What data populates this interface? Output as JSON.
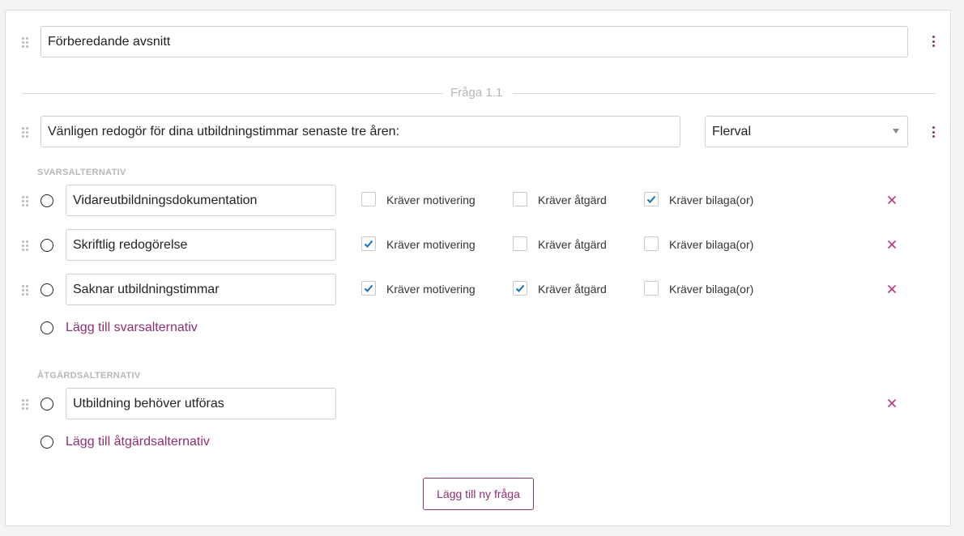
{
  "section": {
    "title_value": "Förberedande avsnitt"
  },
  "question": {
    "divider_label": "Fråga 1.1",
    "text_value": "Vänligen redogör för dina utbildningstimmar senaste tre åren:",
    "type_selected": "Flerval"
  },
  "answers": {
    "label": "SVARSALTERNATIV",
    "checkbox_labels": {
      "motivation": "Kräver motivering",
      "action": "Kräver åtgärd",
      "attachment": "Kräver bilaga(or)"
    },
    "items": [
      {
        "value": "Vidareutbildningsdokumentation",
        "motivation": false,
        "action": false,
        "attachment": true
      },
      {
        "value": "Skriftlig redogörelse",
        "motivation": true,
        "action": false,
        "attachment": false
      },
      {
        "value": "Saknar utbildningstimmar",
        "motivation": true,
        "action": true,
        "attachment": false
      }
    ],
    "add_link": "Lägg till svarsalternativ"
  },
  "actions": {
    "label": "ÅTGÄRDSALTERNATIV",
    "items": [
      {
        "value": "Utbildning behöver utföras"
      }
    ],
    "add_link": "Lägg till åtgärdsalternativ"
  },
  "add_question_button": "Lägg till ny fråga",
  "colors": {
    "accent": "#8e2f73",
    "check": "#1a6fb5",
    "remove": "#c0397f"
  },
  "icons": {
    "drag": "drag-handle-icon",
    "more": "more-vertical-icon",
    "remove": "close-icon",
    "check": "check-icon"
  }
}
